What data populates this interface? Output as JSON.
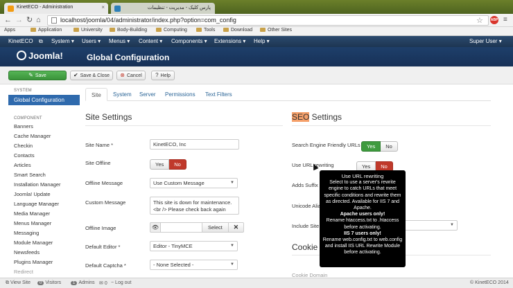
{
  "browser": {
    "tabs": [
      {
        "title": "KinetECO - Administration",
        "active": true
      },
      {
        "title": "پارس کلیک - مدیریت - تنظیمات",
        "active": false
      }
    ],
    "url": "localhost/joomla/04/administrator/index.php?option=com_config",
    "bookmarks": [
      "Apps",
      "Application",
      "University",
      "Body-Building",
      "Computing",
      "Tools",
      "Download",
      "Other Sites"
    ]
  },
  "topmenu": {
    "brand": "KinetECO",
    "items": [
      "System",
      "Users",
      "Menus",
      "Content",
      "Components",
      "Extensions",
      "Help"
    ],
    "user": "Super User"
  },
  "header": {
    "logo": "Joomla!",
    "title": "Global Configuration"
  },
  "toolbar": {
    "save": "Save",
    "save_close": "Save & Close",
    "cancel": "Cancel",
    "help": "Help"
  },
  "sidebar": {
    "system_heading": "SYSTEM",
    "active": "Global Configuration",
    "component_heading": "COMPONENT",
    "components": [
      "Banners",
      "Cache Manager",
      "Checkin",
      "Contacts",
      "Articles",
      "Smart Search",
      "Installation Manager",
      "Joomla! Update",
      "Language Manager",
      "Media Manager",
      "Menus Manager",
      "Messaging",
      "Module Manager",
      "Newsfeeds",
      "Plugins Manager",
      "Redirect"
    ]
  },
  "tabs": [
    "Site",
    "System",
    "Server",
    "Permissions",
    "Text Filters"
  ],
  "site_settings": {
    "heading": "Site Settings",
    "site_name_label": "Site Name *",
    "site_name": "KinetECO, Inc",
    "site_offline_label": "Site Offline",
    "yes": "Yes",
    "no": "No",
    "offline_message_label": "Offline Message",
    "offline_message": "Use Custom Message",
    "custom_message_label": "Custom Message",
    "custom_message_line1": "This site is down for maintenance.",
    "custom_message_line2": "<br /> Please check back again",
    "offline_image_label": "Offline Image",
    "select": "Select",
    "default_editor_label": "Default Editor *",
    "default_editor": "Editor - TinyMCE",
    "default_captcha_label": "Default Captcha *",
    "default_captcha": "- None Selected -"
  },
  "seo_settings": {
    "heading_highlight": "SEO",
    "heading_rest": " Settings",
    "sef_label": "Search Engine Friendly URLs",
    "rewrite_label": "Use URL rewriting",
    "suffix_label": "Adds Suffix",
    "unicode_label": "Unicode Alia",
    "include_label": "Include Site",
    "yes": "Yes",
    "no": "No"
  },
  "cookie": {
    "heading": "Cookie",
    "domain_label": "Cookie Domain"
  },
  "tooltip": {
    "title": "Use URL rewriting",
    "body": "Select to use a server's rewrite engine to catch URLs that meet specific conditions and rewrite them as directed. Available for IIS 7 and Apache.",
    "apache_head": "Apache users only!",
    "apache_body": "Rename htaccess.txt to .htaccess before activating.",
    "iis_head": "IIS 7 users only!",
    "iis_body": "Rename web.config.txt to web.config and install IIS URL Rewrite Module before activating."
  },
  "statusbar": {
    "view_site": "View Site",
    "visitors_count": "0",
    "visitors": "Visitors",
    "admins_count": "1",
    "admins": "Admins",
    "messages_count": "0",
    "logout": "Log out",
    "copyright": "© KinetECO 2014"
  }
}
